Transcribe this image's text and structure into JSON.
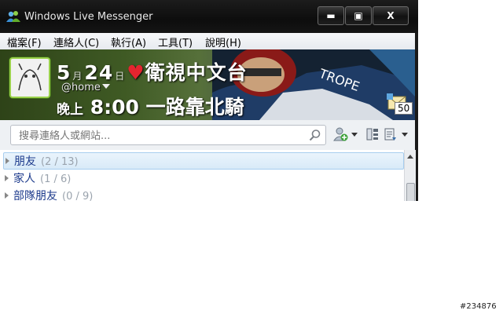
{
  "window": {
    "title": "Windows Live Messenger"
  },
  "caption_buttons": {
    "minimize": "▬",
    "maximize": "▣",
    "close": "X"
  },
  "menu": [
    {
      "label": "檔案(F)"
    },
    {
      "label": "連絡人(C)"
    },
    {
      "label": "執行(A)"
    },
    {
      "label": "工具(T)"
    },
    {
      "label": "說明(H)"
    }
  ],
  "banner": {
    "line1_a": "5",
    "line1_small_a": "月",
    "line1_b": "24",
    "line1_small_b": "日",
    "line1_c": "衛視中文台",
    "status": "@home",
    "line2_a": "晚上",
    "line2_b": "8:00",
    "line2_c": "一路靠北騎",
    "mail_count": "50"
  },
  "search": {
    "placeholder": "搜尋連絡人或網站..."
  },
  "groups": [
    {
      "name": "朋友",
      "count": "(2 / 13)"
    },
    {
      "name": "家人",
      "count": "(1 / 6)"
    },
    {
      "name": "部隊朋友",
      "count": "(0 / 9)"
    }
  ],
  "watermark": "#234876",
  "colors": {
    "titlebar": "#111111",
    "accent": "#1c3a8c",
    "avatar_border": "#9ad14b",
    "selection": "#d8eaf8"
  }
}
